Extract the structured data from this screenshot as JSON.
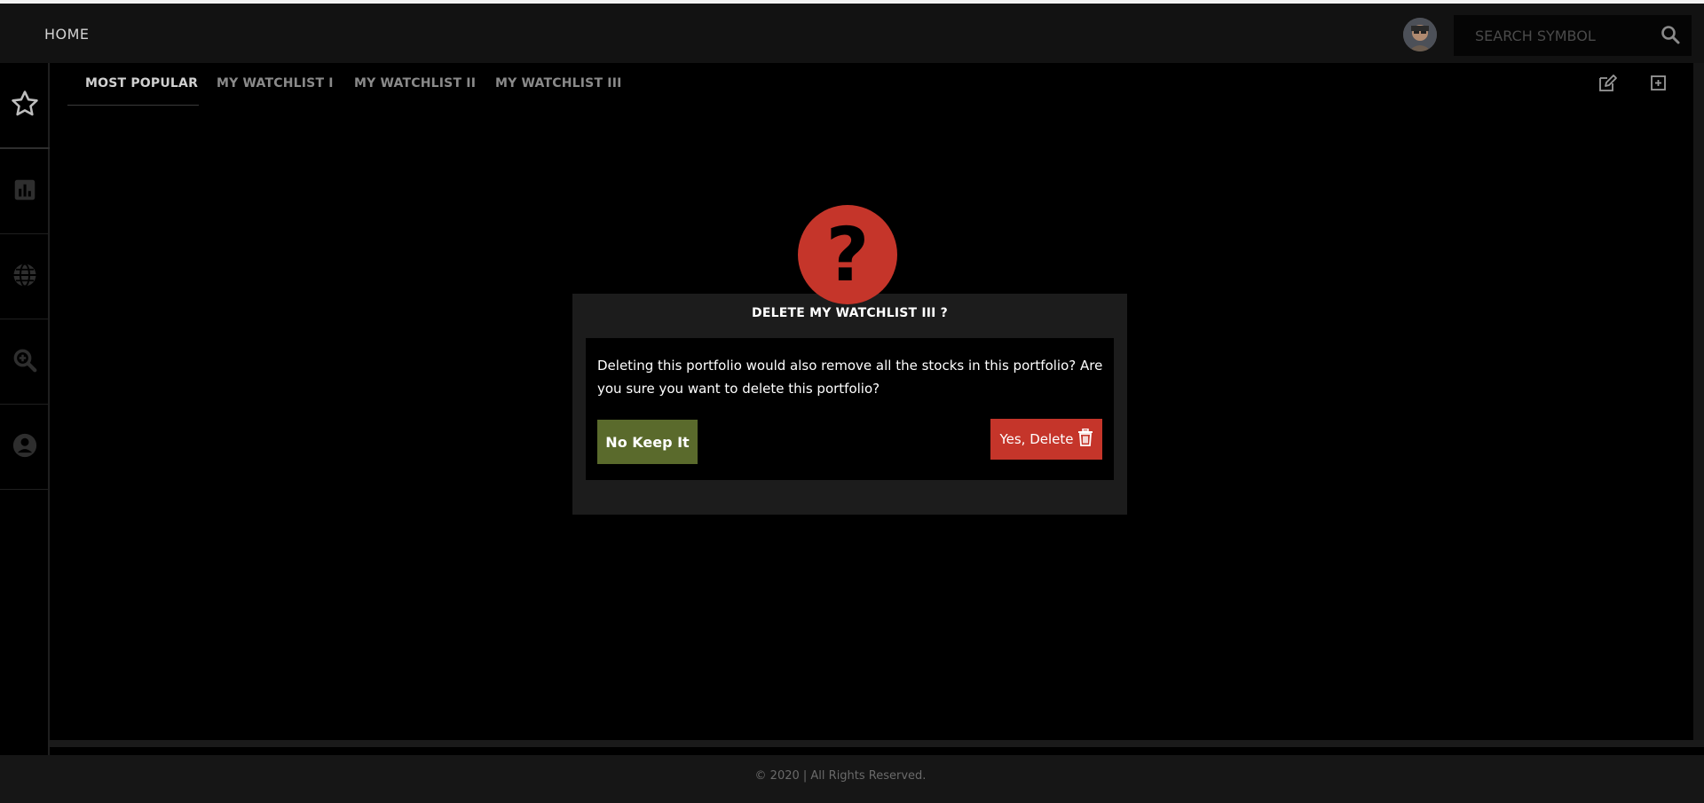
{
  "header": {
    "home_label": "HOME",
    "search_placeholder": "SEARCH SYMBOL"
  },
  "sidebar": {
    "items": [
      {
        "icon": "star-icon"
      },
      {
        "icon": "bar-chart-icon"
      },
      {
        "icon": "globe-icon"
      },
      {
        "icon": "zoom-search-icon"
      },
      {
        "icon": "user-circle-icon"
      }
    ]
  },
  "tabs": [
    {
      "label": "MOST POPULAR",
      "active": true
    },
    {
      "label": "MY WATCHLIST I",
      "active": false
    },
    {
      "label": "MY WATCHLIST II",
      "active": false
    },
    {
      "label": "MY WATCHLIST III",
      "active": false
    }
  ],
  "toolbar": {
    "edit_icon": "edit-icon",
    "add_icon": "add-square-icon"
  },
  "modal": {
    "icon_glyph": "?",
    "title": "DELETE MY WATCHLIST III ?",
    "message": "Deleting this portfolio would also remove all the stocks in this portfolio? Are you sure you want to delete this portfolio?",
    "keep_label": "No Keep It",
    "delete_label": "Yes, Delete"
  },
  "footer": {
    "copyright": "© 2020 | All Rights Reserved."
  },
  "colors": {
    "background": "#000000",
    "header": "#121212",
    "danger": "#c5352a",
    "keep": "#5a6a2c"
  }
}
